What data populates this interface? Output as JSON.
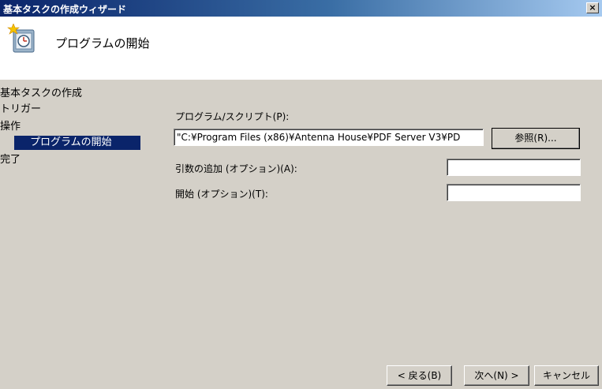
{
  "window": {
    "title": "基本タスクの作成ウィザード",
    "close_glyph": "×"
  },
  "header": {
    "title": "プログラムの開始",
    "icon": "scheduled-task-clock-icon"
  },
  "sidebar": {
    "items": [
      {
        "label": "基本タスクの作成"
      },
      {
        "label": "トリガー"
      },
      {
        "label": "操作"
      },
      {
        "label": "プログラムの開始"
      },
      {
        "label": "完了"
      }
    ]
  },
  "form": {
    "program_label": "プログラム/スクリプト(P):",
    "program_value": "\"C:¥Program Files (x86)¥Antenna House¥PDF Server V3¥PD",
    "browse_label": "参照(R)...",
    "args_label": "引数の追加 (オプション)(A):",
    "args_value": "",
    "start_label": "開始 (オプション)(T):",
    "start_value": ""
  },
  "footer": {
    "back_label": "< 戻る(B)",
    "next_label": "次へ(N) >",
    "cancel_label": "キャンセル"
  },
  "colors": {
    "title_bar": "#0a246a",
    "selected_item": "#0a246a",
    "dialog_bg": "#d4d0c8"
  }
}
